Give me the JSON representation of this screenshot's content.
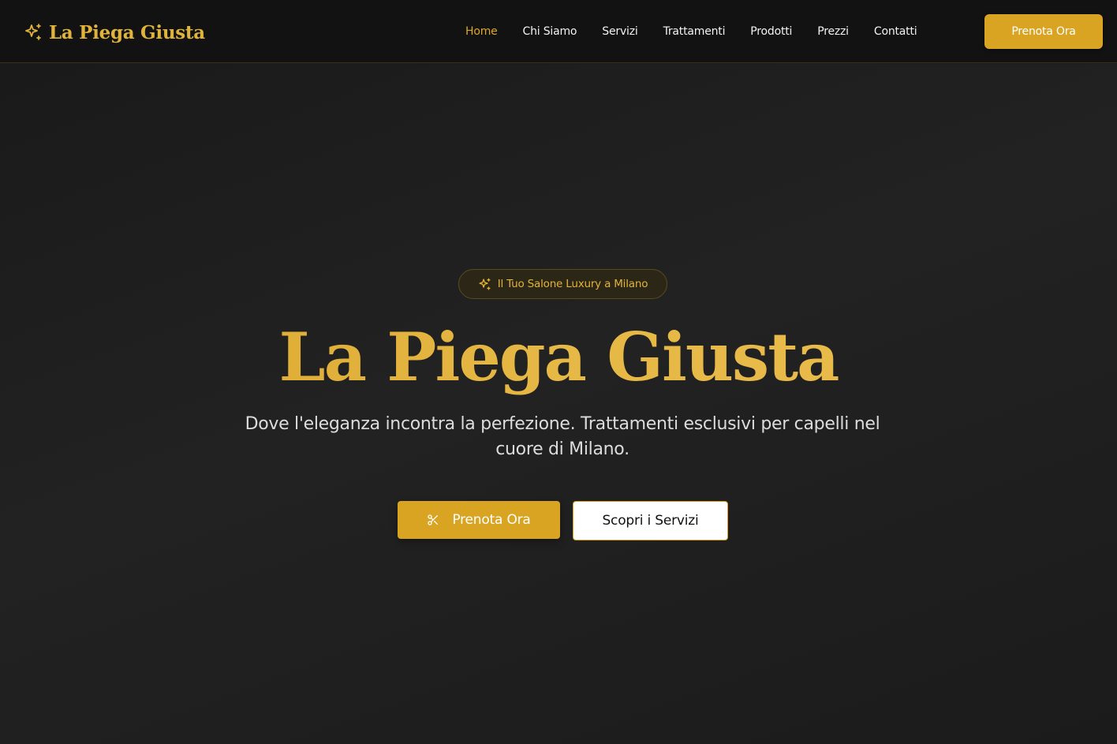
{
  "colors": {
    "accent": "#d8a422",
    "gold_text": "#e0b43a",
    "header_bg": "#121212",
    "hero_bg": "#1b1b1b",
    "nav_text": "#f2f2f2",
    "nav_active": "#dca72a"
  },
  "header": {
    "brand": {
      "icon": "sparkle-icon",
      "name": "La Piega Giusta"
    },
    "nav": [
      {
        "label": "Home",
        "active": true
      },
      {
        "label": "Chi Siamo",
        "active": false
      },
      {
        "label": "Servizi",
        "active": false
      },
      {
        "label": "Trattamenti",
        "active": false
      },
      {
        "label": "Prodotti",
        "active": false
      },
      {
        "label": "Prezzi",
        "active": false
      },
      {
        "label": "Contatti",
        "active": false
      }
    ],
    "cta_label": "Prenota Ora"
  },
  "hero": {
    "badge": {
      "icon": "sparkle-icon",
      "text": "Il Tuo Salone Luxury a Milano"
    },
    "title": "La Piega Giusta",
    "subtitle": "Dove l'eleganza incontra la perfezione. Trattamenti esclusivi per capelli nel cuore di Milano.",
    "primary_button": {
      "icon": "scissors-icon",
      "label": "Prenota Ora"
    },
    "secondary_button": {
      "label": "Scopri i Servizi"
    }
  }
}
